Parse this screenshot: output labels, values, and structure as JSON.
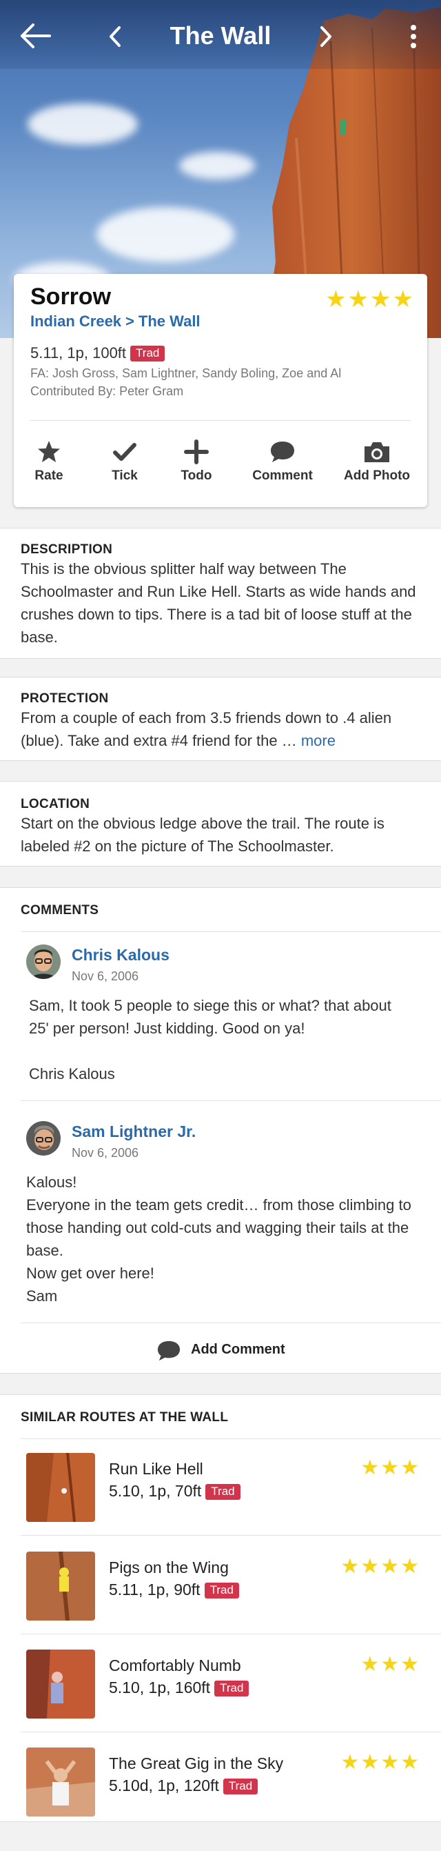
{
  "header": {
    "title": "The Wall"
  },
  "route": {
    "name": "Sorrow",
    "stars": "★★★★",
    "breadcrumb": [
      "Indian Creek",
      "The Wall"
    ],
    "breadcrumb_sep": ">",
    "grade": "5.11, 1p, 100ft",
    "type": "Trad",
    "fa": "FA: Josh Gross, Sam Lightner, Sandy Boling, Zoe and Al",
    "contributed": "Contributed By: Peter Gram"
  },
  "actions": [
    {
      "label": "Rate",
      "icon": "star-icon"
    },
    {
      "label": "Tick",
      "icon": "checkmark-icon"
    },
    {
      "label": "Todo",
      "icon": "plus-icon"
    },
    {
      "label": "Comment",
      "icon": "speech-bubble-icon"
    },
    {
      "label": "Add Photo",
      "icon": "camera-icon"
    }
  ],
  "description": {
    "heading": "DESCRIPTION",
    "text": "This is the obvious splitter half way between The Schoolmaster and Run Like Hell. Starts as wide hands and crushes down to tips. There is a tad bit of loose stuff at the base."
  },
  "protection": {
    "heading": "PROTECTION",
    "text": "From a couple of each from 3.5 friends down to .4 alien (blue). Take and extra #4 friend for the …",
    "more": "more"
  },
  "location": {
    "heading": "LOCATION",
    "text": "Start on the obvious ledge above the trail. The route is labeled #2 on the picture of The Schoolmaster."
  },
  "comments": {
    "heading": "COMMENTS",
    "items": [
      {
        "author": "Chris Kalous",
        "date": "Nov 6, 2006",
        "text": "Sam, It took 5 people to siege this or what? that about 25' per person! Just kidding. Good on ya!\n\nChris Kalous"
      },
      {
        "author": "Sam Lightner Jr.",
        "date": "Nov 6, 2006",
        "text": "Kalous!\nEveryone in the team gets credit… from those climbing to those handing out cold-cuts and wagging their tails at the base.\nNow get over here!\nSam"
      }
    ],
    "add_label": "Add Comment"
  },
  "similar": {
    "heading": "SIMILAR ROUTES AT THE WALL",
    "items": [
      {
        "name": "Run Like Hell",
        "grade": "5.10, 1p, 70ft",
        "type": "Trad",
        "stars": "★★★"
      },
      {
        "name": "Pigs on the Wing",
        "grade": "5.11, 1p, 90ft",
        "type": "Trad",
        "stars": "★★★★"
      },
      {
        "name": "Comfortably Numb",
        "grade": "5.10, 1p, 160ft",
        "type": "Trad",
        "stars": "★★★"
      },
      {
        "name": "The Great Gig in the Sky",
        "grade": "5.10d, 1p, 120ft",
        "type": "Trad",
        "stars": "★★★★"
      }
    ]
  },
  "colors": {
    "link": "#2b6aa8",
    "star": "#f5d515",
    "badge": "#d2344c"
  }
}
